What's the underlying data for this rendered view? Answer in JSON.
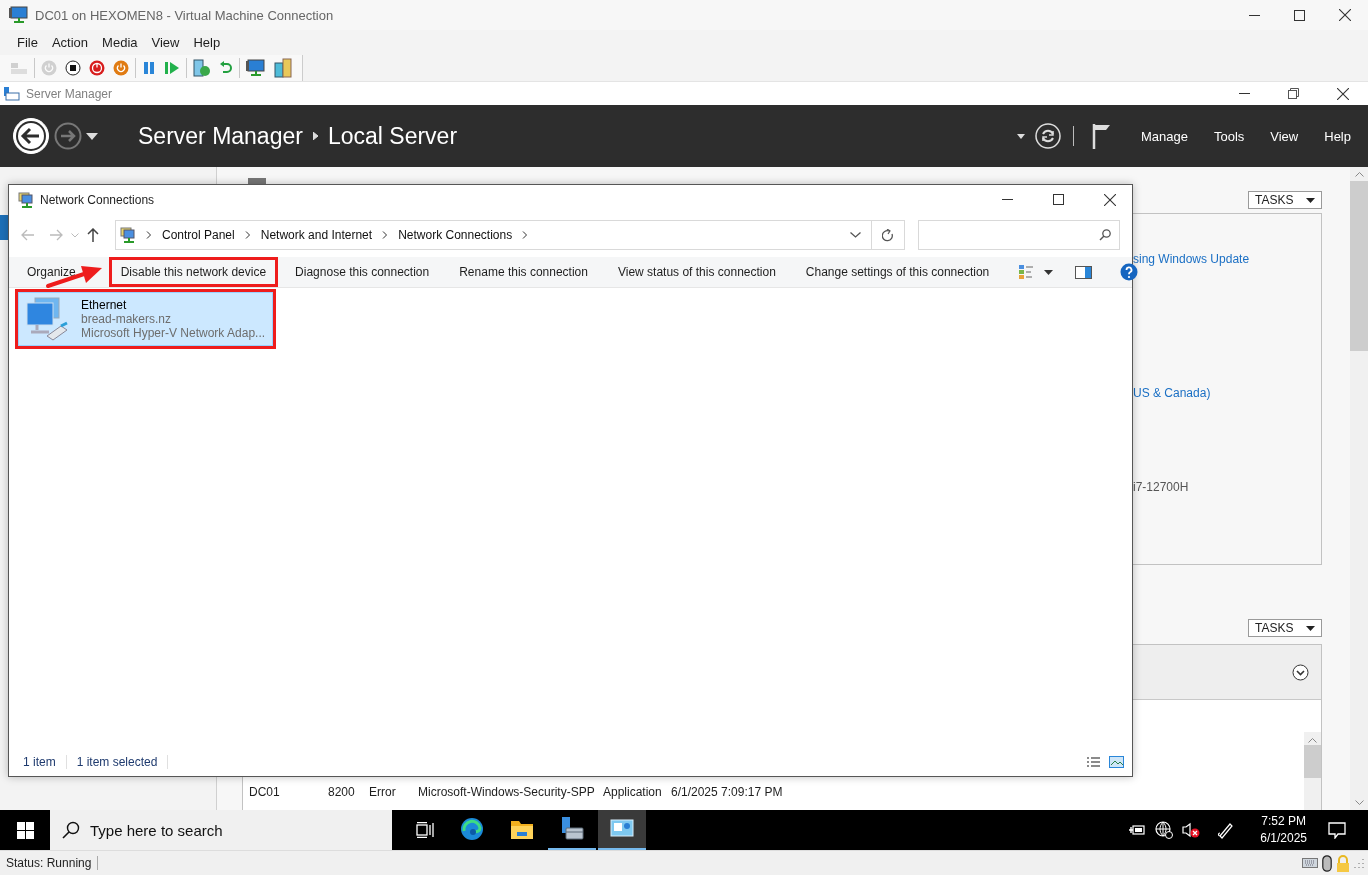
{
  "vm_window": {
    "title": "DC01 on HEXOMEN8 - Virtual Machine Connection"
  },
  "menu": [
    "File",
    "Action",
    "Media",
    "View",
    "Help"
  ],
  "toolbar": [
    [
      {
        "kind": "keys",
        "disabled": true
      }
    ],
    [
      {
        "kind": "power",
        "disabled": true
      },
      {
        "kind": "stop",
        "disabled": false
      },
      {
        "kind": "shutdown",
        "disabled": false
      },
      {
        "kind": "save",
        "disabled": false
      }
    ],
    [
      {
        "kind": "pause",
        "disabled": false
      },
      {
        "kind": "play",
        "disabled": false
      }
    ],
    [
      {
        "kind": "checkpoint",
        "disabled": false
      },
      {
        "kind": "revert",
        "disabled": false
      }
    ],
    [
      {
        "kind": "session",
        "disabled": false
      },
      {
        "kind": "share",
        "disabled": false
      }
    ]
  ],
  "server_manager": {
    "title": "Server Manager",
    "breadcrumb": [
      "Server Manager",
      "Local Server"
    ],
    "menu": [
      "Manage",
      "Tools",
      "View",
      "Help"
    ],
    "properties": {
      "tasks": "TASKS",
      "values": [
        {
          "kind": "link",
          "text": "sing Windows Update"
        },
        {
          "kind": "link",
          "text": "US & Canada)"
        },
        {
          "kind": "text",
          "text": "i7-12700H"
        }
      ]
    },
    "events": {
      "tasks": "TASKS",
      "row": [
        "DC01",
        "8200",
        "Error",
        "Microsoft-Windows-Security-SPP",
        "Application",
        "6/1/2025 7:09:17 PM"
      ]
    }
  },
  "network_connections": {
    "title": "Network Connections",
    "address": [
      "Control Panel",
      "Network and Internet",
      "Network Connections"
    ],
    "commands": [
      {
        "label": "Organize",
        "highlighted": false
      },
      {
        "label": "Disable this network device",
        "highlighted": true
      },
      {
        "label": "Diagnose this connection",
        "highlighted": false
      },
      {
        "label": "Rename this connection",
        "highlighted": false
      },
      {
        "label": "View status of this connection",
        "highlighted": false
      },
      {
        "label": "Change settings of this connection",
        "highlighted": false
      }
    ],
    "items": [
      {
        "name": "Ethernet",
        "network": "bread-makers.nz",
        "adapter": "Microsoft Hyper-V Network Adap...",
        "selected": true,
        "highlighted": true
      }
    ],
    "annotation_arrow": true,
    "status": [
      "1 item",
      "1 item selected"
    ]
  },
  "taskbar": {
    "search": {
      "placeholder": "Type here to search"
    },
    "apps": [
      {
        "kind": "browser",
        "running": false,
        "selected": false
      },
      {
        "kind": "folder",
        "running": false,
        "selected": false
      },
      {
        "kind": "server",
        "running": true,
        "selected": false
      },
      {
        "kind": "monitor",
        "running": true,
        "selected": true
      }
    ],
    "time": "7:52 PM",
    "date": "6/1/2025"
  },
  "status_bar": {
    "text": "Status: Running"
  }
}
